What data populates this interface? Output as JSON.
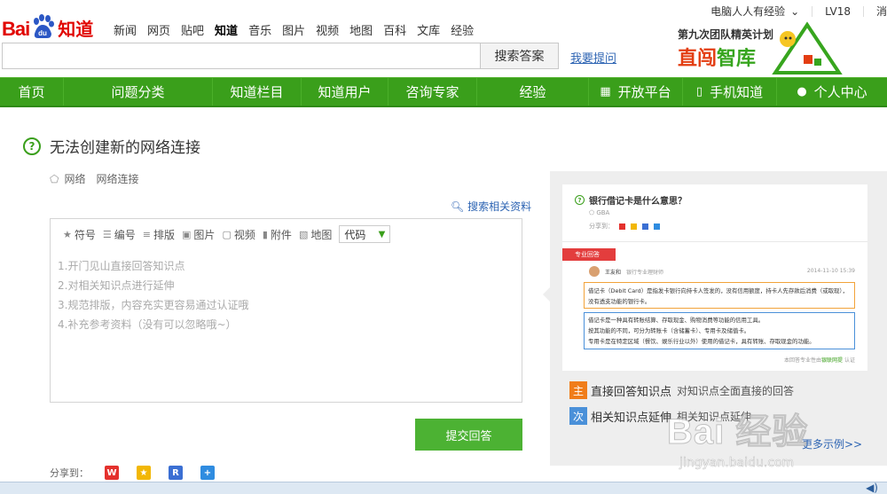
{
  "brand": {
    "logo_bai": "Bai",
    "logo_du": "du",
    "logo_zhi": "知道"
  },
  "top_nav": [
    "新闻",
    "网页",
    "贴吧",
    "知道",
    "音乐",
    "图片",
    "视频",
    "地图",
    "百科",
    "文库",
    "经验"
  ],
  "top_nav_active": "知道",
  "user": {
    "name": "电脑人人有经验",
    "level": "LV18",
    "message": "消息"
  },
  "search": {
    "value": "",
    "button_label": "搜索答案",
    "ask_link": "我要提问"
  },
  "banner": {
    "line1_bold": "第九次",
    "line1_rest": "团队精英计划",
    "line2_red": "直闯",
    "line2_green": "智库"
  },
  "main_nav": [
    {
      "label": "首页",
      "icon": ""
    },
    {
      "label": "问题分类",
      "icon": ""
    },
    {
      "label": "知道栏目",
      "icon": ""
    },
    {
      "label": "知道用户",
      "icon": ""
    },
    {
      "label": "咨询专家",
      "icon": ""
    },
    {
      "label": "经验",
      "icon": ""
    },
    {
      "label": "开放平台",
      "icon": "grid-icon"
    },
    {
      "label": "手机知道",
      "icon": "phone-icon"
    },
    {
      "label": "个人中心",
      "icon": "user-icon"
    }
  ],
  "question": {
    "title": "无法创建新的网络连接",
    "tags": [
      "网络",
      "网络连接"
    ]
  },
  "search_related": "搜索相关资料",
  "editor": {
    "toolbar": [
      "符号",
      "编号",
      "排版",
      "图片",
      "视频",
      "附件",
      "地图"
    ],
    "code_select": "代码",
    "placeholder_lines": [
      "1.开门见山直接回答知识点",
      "2.对相关知识点进行延伸",
      "3.规范排版，内容充实更容易通过认证哦",
      "4.补充参考资料（没有可以忽略哦~）"
    ]
  },
  "submit_label": "提交回答",
  "share_label": "分享到：",
  "example": {
    "question": "银行借记卡是什么意思？",
    "tag": "GBA",
    "share": "分享到：",
    "badge": "专业回答",
    "author": "王友和",
    "author_title": "银行专业理财师",
    "date": "2014-11-10  15:39",
    "box1": "借记卡（Debit Card）是指发卡银行向持卡人签发的，没有信用额度，持卡人先存款后消费（或取现），没有透支功能的银行卡。",
    "box2_lines": [
      "借记卡是一种具有转账结算、存取现金、购物消费等功能的信用工具。",
      "按其功能的不同，可分为转账卡（含储蓄卡）、专用卡及储值卡。",
      "专用卡是在特定区域（餐饮、娱乐行业以外）使用的借记卡，具有转账、存取现金的功能。"
    ],
    "footer_pre": "本回答专业性由",
    "footer_link": "银联网提",
    "footer_post": "认证"
  },
  "legend": [
    {
      "mark": "主",
      "title": "直接回答知识点",
      "desc": "对知识点全面直接的回答",
      "color": "#f07d1a"
    },
    {
      "mark": "次",
      "title": "相关知识点延伸",
      "desc": "相关知识点延伸",
      "color": "#4a90d9"
    }
  ],
  "more_examples": "更多示例>>",
  "watermark": {
    "text": "Bai 经验",
    "url": "jingyan.baidu.com"
  },
  "colors": {
    "brand_red": "#e10601",
    "nav_green": "#3a9f1b",
    "submit_green": "#4cb233",
    "link_blue": "#2d64b3"
  }
}
